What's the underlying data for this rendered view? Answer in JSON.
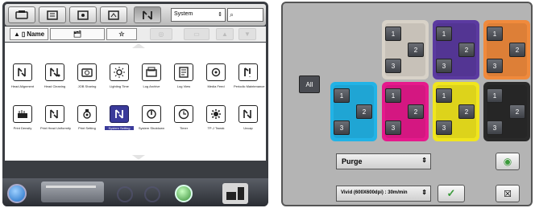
{
  "left_panel": {
    "category_select": {
      "value": "System"
    },
    "sort": {
      "name_label": "Name"
    },
    "items": [
      {
        "label": "Head Alignment",
        "icon": "alignment-icon"
      },
      {
        "label": "Head Cleaning",
        "icon": "cleaning-icon"
      },
      {
        "label": "JOB Sharing",
        "icon": "job-sharing-icon"
      },
      {
        "label": "Lighting Time",
        "icon": "lighting-icon"
      },
      {
        "label": "Log Archive",
        "icon": "log-archive-icon"
      },
      {
        "label": "Log View",
        "icon": "log-view-icon"
      },
      {
        "label": "Media Feed",
        "icon": "media-feed-icon"
      },
      {
        "label": "Periodic Maintenance",
        "icon": "maintenance-icon"
      },
      {
        "label": "Print Density",
        "icon": "density-icon"
      },
      {
        "label": "Print Head Uniformity",
        "icon": "uniformity-icon"
      },
      {
        "label": "Print Setting",
        "icon": "print-setting-icon"
      },
      {
        "label": "System Setting",
        "icon": "system-setting-icon",
        "selected": true
      },
      {
        "label": "System Shutdown",
        "icon": "shutdown-icon"
      },
      {
        "label": "Timer",
        "icon": "timer-icon"
      },
      {
        "label": "TP-J Tweak",
        "icon": "tweak-icon"
      },
      {
        "label": "Uncap",
        "icon": "uncap-icon"
      }
    ]
  },
  "right_panel": {
    "all_label": "All",
    "heads": [
      {
        "color": "#d8d2c8",
        "nozzles": [
          "1",
          "2",
          "3"
        ]
      },
      {
        "color": "#5b3aa0",
        "nozzles": [
          "1",
          "2",
          "3"
        ]
      },
      {
        "color": "#f08a3c",
        "nozzles": [
          "1",
          "2",
          "3"
        ]
      },
      {
        "color": "#22b3e6",
        "nozzles": [
          "1",
          "2",
          "3"
        ]
      },
      {
        "color": "#e6198c",
        "nozzles": [
          "1",
          "2",
          "3"
        ]
      },
      {
        "color": "#f0e51e",
        "nozzles": [
          "1",
          "2",
          "3"
        ]
      },
      {
        "color": "#2a2a2a",
        "nozzles": [
          "1",
          "2",
          "3"
        ]
      }
    ],
    "action_select": {
      "value": "Purge"
    },
    "mode_select": {
      "value": "Vivid (600X600dpi) : 30m/min"
    }
  }
}
